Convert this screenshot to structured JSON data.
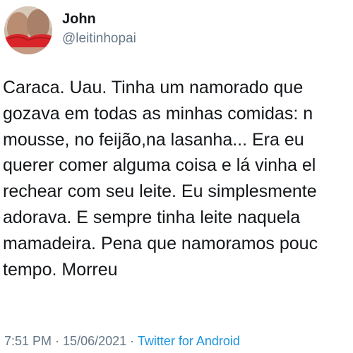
{
  "tweet": {
    "author_name": "John",
    "author_handle": "@leitinhopai",
    "text_lines": [
      "Caraca. Uau. Tinha um namorado que",
      "gozava em todas as minhas comidas: n",
      "mousse, no feijão,na lasanha... Era eu",
      "querer comer alguma coisa e lá vinha el",
      "rechear com seu leite. Eu simplesmente",
      "adorava. E sempre tinha leite naquela",
      "mamadeira. Pena que namoramos pouc",
      "tempo. Morreu"
    ],
    "time": "7:51 PM",
    "separator": " · ",
    "date": "15/06/2021",
    "source": "Twitter for Android"
  },
  "colors": {
    "text": "#14171a",
    "secondary": "#657786",
    "link": "#1b95e0",
    "background": "#ffffff"
  },
  "icons": {
    "avatar": "profile-photo"
  }
}
